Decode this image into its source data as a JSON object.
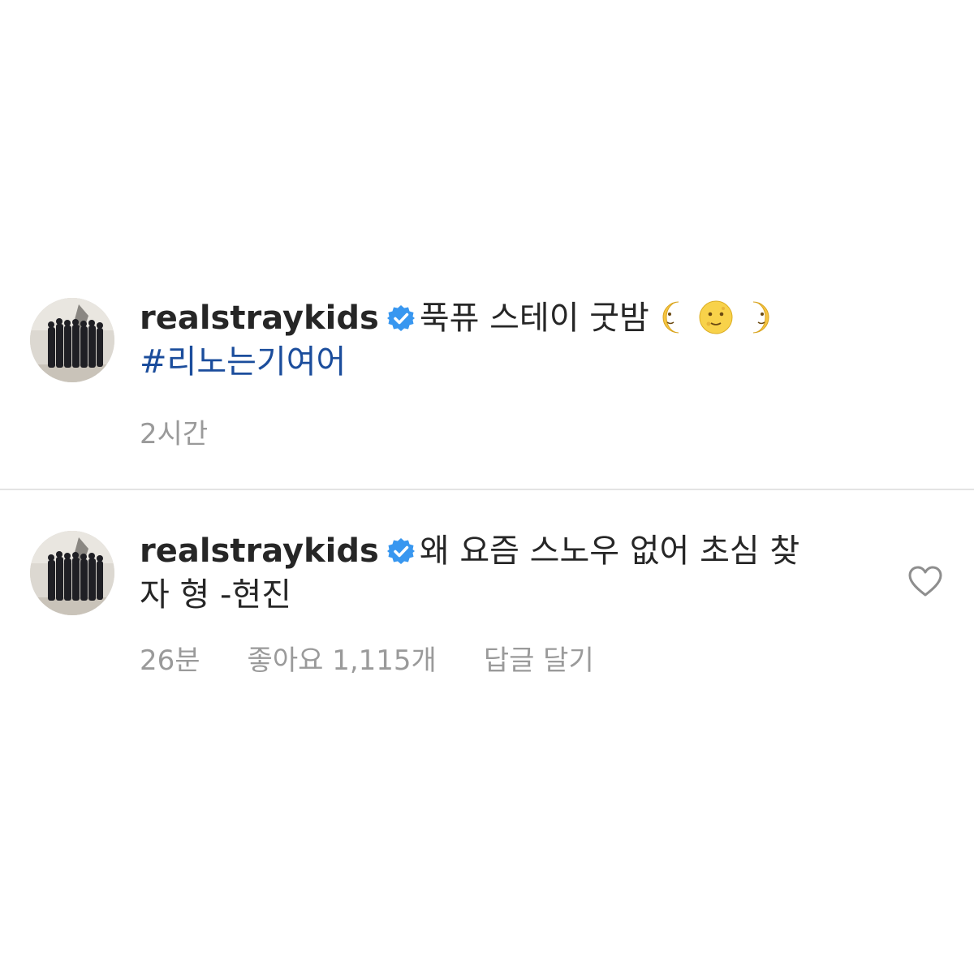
{
  "caption": {
    "username": "realstraykids",
    "text": "푹퓨 스테이 굿밤",
    "emojis": [
      "waxing-crescent-moon-face-icon",
      "full-moon-face-icon",
      "last-quarter-moon-face-icon"
    ],
    "hashtag": "#리노는기여어",
    "time": "2시간"
  },
  "comment": {
    "username": "realstraykids",
    "text_line1": "왜 요즘 스노우 없어 초심 찾",
    "text_line2": "자 형 -현진",
    "time": "26분",
    "likes": "좋아요 1,115개",
    "reply": "답글 달기"
  },
  "colors": {
    "verified": "#3897f0",
    "hashtag": "#1b4d9c",
    "meta_text": "#9a9a9a",
    "divider": "#e3e3e3"
  }
}
